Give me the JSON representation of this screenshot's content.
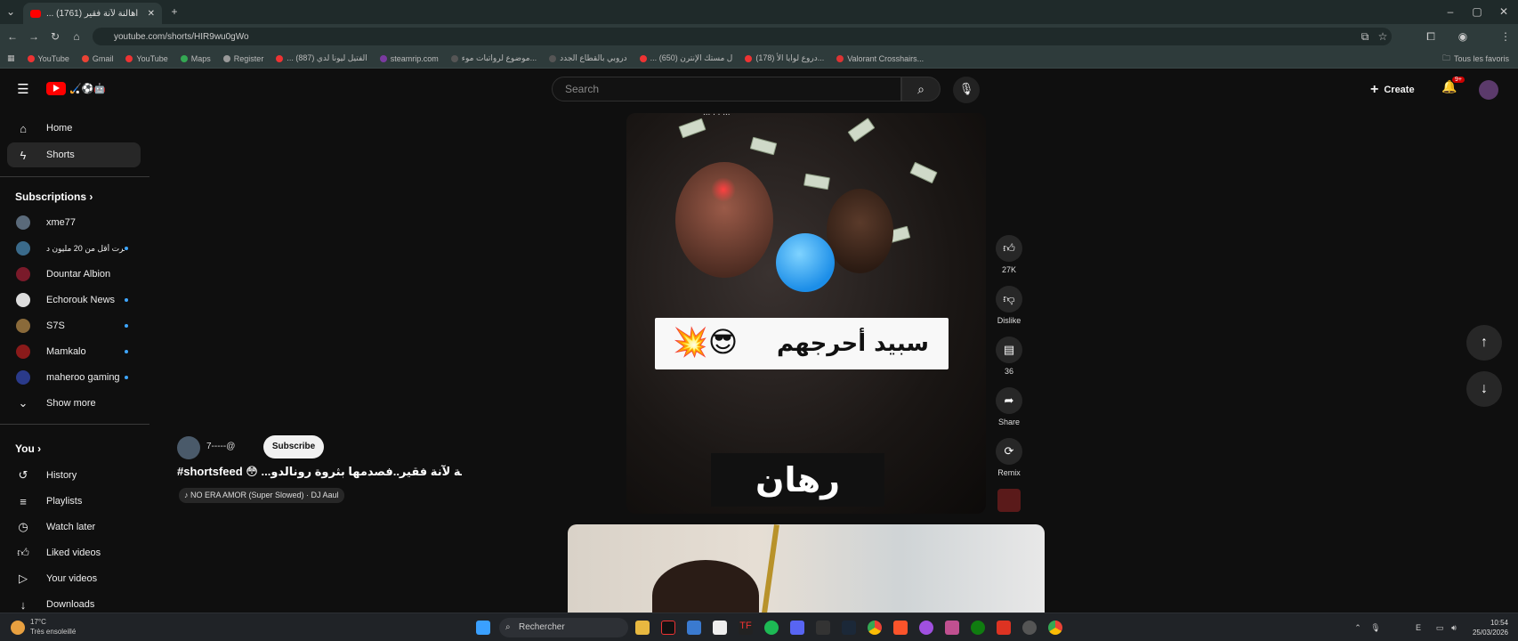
{
  "browser": {
    "tab_title": "... أهالنة لآنة فقير (1761)",
    "url": "youtube.com/shorts/HIR9wu0gWo",
    "bookmarks": [
      "YouTube",
      "Gmail",
      "YouTube",
      "Maps",
      "Register",
      "... الفتيل ليونا لدي (887)",
      "steamrip.com",
      "موضوع لرواتبات موء...",
      "دروبي بالقطاع الجدد",
      "... ل مستك الإنترن (650)",
      "(178) دروع لوايا الأ...",
      "Valorant Crosshairs..."
    ],
    "all_bookmarks": "Tous les favoris"
  },
  "youtube": {
    "logo_text": "🏑⚽🤖",
    "search_placeholder": "Search",
    "create_label": "Create",
    "notif_badge": "9+"
  },
  "sidebar": {
    "main": [
      {
        "label": "Home",
        "icon": "home-icon"
      },
      {
        "label": "Shorts",
        "icon": "shorts-icon"
      }
    ],
    "subscriptions_title": "Subscriptions",
    "subscriptions": [
      {
        "label": "xme77",
        "color": "#5a6a7a"
      },
      {
        "label": "ـرت أقل من 20 مليون د...",
        "color": "#3a6a8a"
      },
      {
        "label": "Dountar Albion",
        "color": "#7a1a2a"
      },
      {
        "label": "Echorouk News",
        "color": "#dddddd"
      },
      {
        "label": "S7S",
        "color": "#8a6a3a"
      },
      {
        "label": "Mamkalo",
        "color": "#8a1a1a"
      },
      {
        "label": "maheroo gaming",
        "color": "#2a3a8a"
      }
    ],
    "show_more": "Show more",
    "you_title": "You",
    "you_items": [
      {
        "label": "History",
        "icon": "history-icon"
      },
      {
        "label": "Playlists",
        "icon": "playlists-icon"
      },
      {
        "label": "Watch later",
        "icon": "watch-later-icon"
      },
      {
        "label": "Liked videos",
        "icon": "liked-icon"
      },
      {
        "label": "Your videos",
        "icon": "your-videos-icon"
      },
      {
        "label": "Downloads",
        "icon": "downloads-icon"
      }
    ]
  },
  "short": {
    "top_overlay": "... . . ...",
    "caption_text": "سبيد أحرجهم",
    "caption_emoji": "💥😎",
    "bottom_text": "رهان",
    "channel_name": "7-----@",
    "subscribe_label": "Subscribe",
    "title": "#shortsfeed 😳 ...أهالنة لآنة فقير..فصدمها بثروة رونالدو!",
    "sound": "♪ NO ERA AMOR (Super Slowed) · DJ Aaul"
  },
  "actions": {
    "like_count": "27K",
    "dislike_label": "Dislike",
    "comments_count": "36",
    "share_label": "Share",
    "remix_label": "Remix"
  },
  "taskbar": {
    "temp": "17°C",
    "weather": "Très ensoleillé",
    "search_label": "Rechercher",
    "time": "10:54",
    "date": "25/03/2026",
    "lang": "E"
  }
}
